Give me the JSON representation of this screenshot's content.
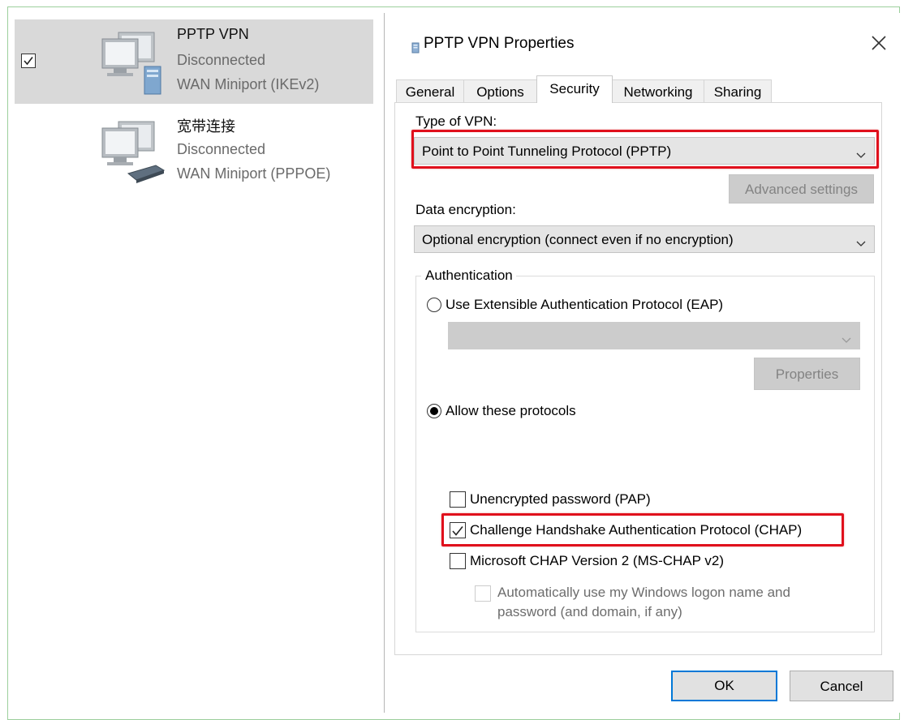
{
  "connections": [
    {
      "name": "PPTP VPN",
      "status": "Disconnected",
      "device": "WAN Miniport (IKEv2)",
      "checked": true
    },
    {
      "name": "宽带连接",
      "status": "Disconnected",
      "device": "WAN Miniport (PPPOE)"
    }
  ],
  "dialog": {
    "title": "PPTP VPN Properties",
    "tabs": [
      "General",
      "Options",
      "Security",
      "Networking",
      "Sharing"
    ],
    "active_tab": "Security",
    "type_of_vpn_label": "Type of VPN:",
    "type_of_vpn_value": "Point to Point Tunneling Protocol (PPTP)",
    "advanced_settings_label": "Advanced settings",
    "data_encryption_label": "Data encryption:",
    "data_encryption_value": "Optional encryption (connect even if no encryption)",
    "authentication_label": "Authentication",
    "eap_label": "Use Extensible Authentication Protocol (EAP)",
    "eap_selected": false,
    "eap_properties_label": "Properties",
    "allow_protocols_label": "Allow these protocols",
    "allow_protocols_selected": true,
    "protocols": [
      {
        "label": "Unencrypted password (PAP)",
        "checked": false
      },
      {
        "label": "Challenge Handshake Authentication Protocol (CHAP)",
        "checked": true
      },
      {
        "label": "Microsoft CHAP Version 2 (MS-CHAP v2)",
        "checked": false
      }
    ],
    "auto_logon_line1": "Automatically use my Windows logon name and",
    "auto_logon_line2": "password (and domain, if any)",
    "ok_label": "OK",
    "cancel_label": "Cancel"
  },
  "colors": {
    "highlight": "#e0101c",
    "selected_row": "#d9d9d9",
    "default_button_border": "#0078d7"
  }
}
